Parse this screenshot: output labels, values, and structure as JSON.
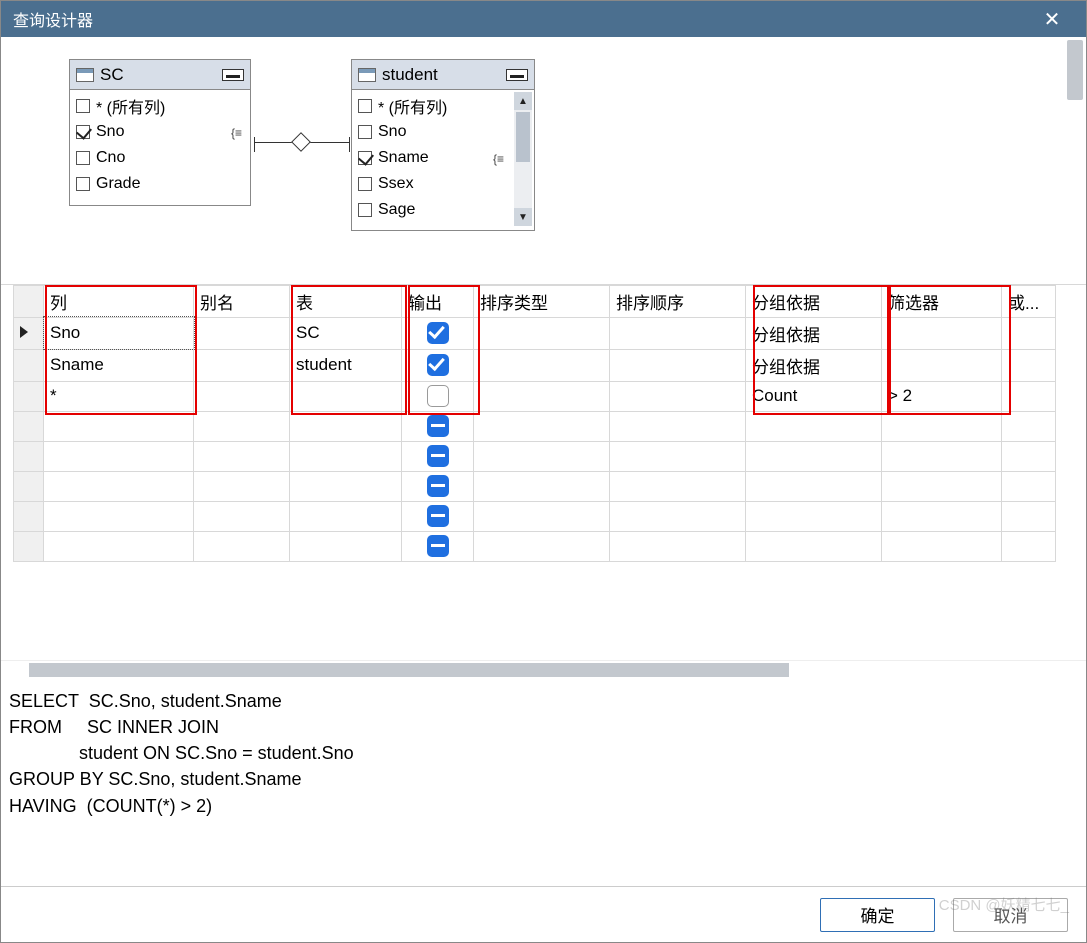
{
  "window": {
    "title": "查询设计器"
  },
  "tables": {
    "sc": {
      "name": "SC",
      "columns": [
        {
          "label": "* (所有列)",
          "checked": false
        },
        {
          "label": "Sno",
          "checked": true,
          "key": true
        },
        {
          "label": "Cno",
          "checked": false
        },
        {
          "label": "Grade",
          "checked": false
        }
      ]
    },
    "student": {
      "name": "student",
      "columns": [
        {
          "label": "* (所有列)",
          "checked": false
        },
        {
          "label": "Sno",
          "checked": false
        },
        {
          "label": "Sname",
          "checked": true,
          "key": true
        },
        {
          "label": "Ssex",
          "checked": false
        },
        {
          "label": "Sage",
          "checked": false
        }
      ]
    }
  },
  "grid": {
    "headers": {
      "col": "列",
      "alias": "别名",
      "table": "表",
      "output": "输出",
      "sortType": "排序类型",
      "sortOrder": "排序顺序",
      "groupBy": "分组依据",
      "filter": "筛选器",
      "or": "或..."
    },
    "rows": [
      {
        "col": "Sno",
        "alias": "",
        "table": "SC",
        "output": "checked",
        "sortType": "",
        "sortOrder": "",
        "groupBy": "分组依据",
        "filter": ""
      },
      {
        "col": "Sname",
        "alias": "",
        "table": "student",
        "output": "checked",
        "sortType": "",
        "sortOrder": "",
        "groupBy": "分组依据",
        "filter": ""
      },
      {
        "col": "*",
        "alias": "",
        "table": "",
        "output": "empty",
        "sortType": "",
        "sortOrder": "",
        "groupBy": "Count",
        "filter": "> 2"
      },
      {
        "col": "",
        "alias": "",
        "table": "",
        "output": "dash",
        "sortType": "",
        "sortOrder": "",
        "groupBy": "",
        "filter": ""
      },
      {
        "col": "",
        "alias": "",
        "table": "",
        "output": "dash",
        "sortType": "",
        "sortOrder": "",
        "groupBy": "",
        "filter": ""
      },
      {
        "col": "",
        "alias": "",
        "table": "",
        "output": "dash",
        "sortType": "",
        "sortOrder": "",
        "groupBy": "",
        "filter": ""
      },
      {
        "col": "",
        "alias": "",
        "table": "",
        "output": "dash",
        "sortType": "",
        "sortOrder": "",
        "groupBy": "",
        "filter": ""
      },
      {
        "col": "",
        "alias": "",
        "table": "",
        "output": "dash",
        "sortType": "",
        "sortOrder": "",
        "groupBy": "",
        "filter": ""
      }
    ],
    "colWidths": {
      "rowhead": 30,
      "col": 150,
      "alias": 96,
      "table": 112,
      "output": 72,
      "sort": 136,
      "order": 136,
      "group": 136,
      "filter": 120,
      "or": 54
    }
  },
  "sql": "SELECT  SC.Sno, student.Sname\nFROM     SC INNER JOIN\n              student ON SC.Sno = student.Sno\nGROUP BY SC.Sno, student.Sname\nHAVING  (COUNT(*) > 2)",
  "buttons": {
    "ok": "确定",
    "cancel": "取消"
  },
  "watermark": "CSDN @妖精七七_"
}
